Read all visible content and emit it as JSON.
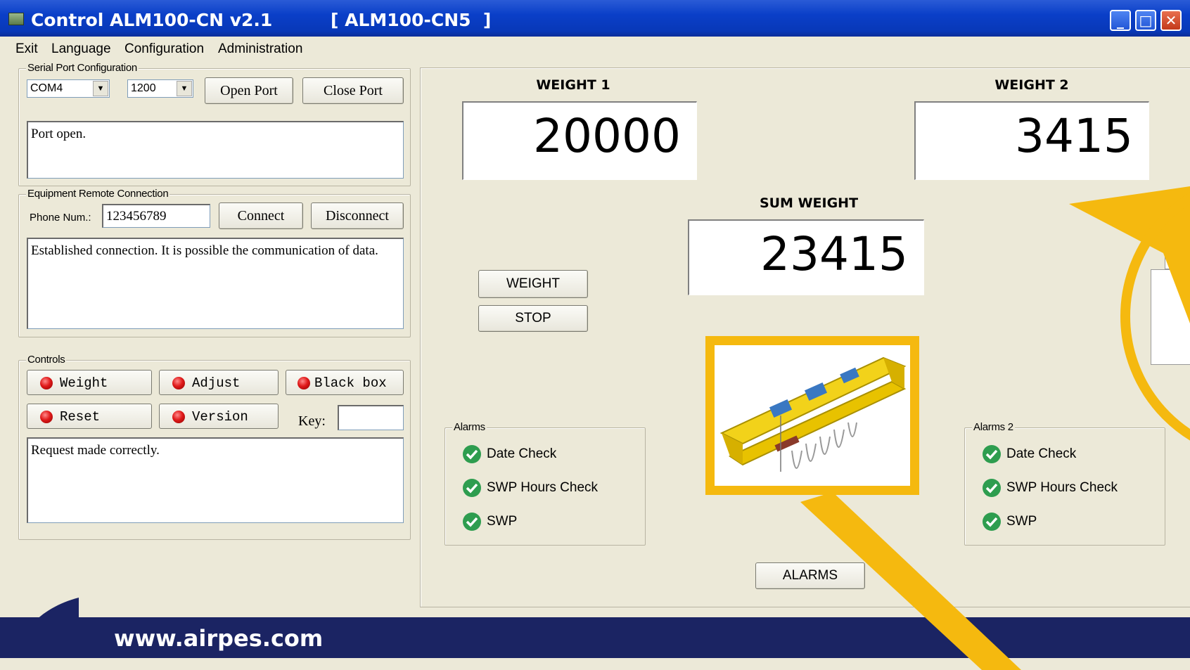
{
  "window": {
    "title": "Control ALM100-CN v2.1",
    "model": "[ ALM100-CN5  ]",
    "minimize": "_",
    "maximize": "□",
    "close": "✕"
  },
  "menu": {
    "items": [
      "Exit",
      "Language",
      "Configuration",
      "Administration"
    ]
  },
  "serial": {
    "group_label": "Serial Port Configuration",
    "port": "COM4",
    "baud": "1200",
    "open_label": "Open Port",
    "close_label": "Close Port",
    "status": "Port open."
  },
  "remote": {
    "group_label": "Equipment Remote Connection",
    "phone_label": "Phone Num.:",
    "phone_value": "123456789",
    "connect_label": "Connect",
    "disconnect_label": "Disconnect",
    "status": "Established connection. It is possible the communication of data."
  },
  "controls": {
    "group_label": "Controls",
    "weight": "Weight",
    "adjust": "Adjust",
    "blackbox": "Black box",
    "reset": "Reset",
    "version": "Version",
    "key_label": "Key:",
    "key_value": "",
    "status": "Request made correctly."
  },
  "weights": {
    "w1_label": "WEIGHT 1",
    "w1_value": "20000",
    "w2_label": "WEIGHT 2",
    "w2_value": "3415",
    "sum_label": "SUM WEIGHT",
    "sum_value": "23415",
    "weight_btn": "WEIGHT",
    "stop_btn": "STOP"
  },
  "alarms": {
    "group1_label": "Alarms",
    "group2_label": "Alarms 2",
    "items": [
      "Date Check",
      "SWP Hours Check",
      "SWP"
    ],
    "alarms_btn": "ALARMS"
  },
  "footer": {
    "url": "www.airpes.com"
  },
  "colors": {
    "titlebar": "#0a3fc8",
    "highlight": "#f5b90f",
    "footer": "#1b2463",
    "check": "#2e9d4f",
    "led": "#e01a1a"
  },
  "icons": [
    "app-icon",
    "check-icon",
    "led-icon",
    "chevron-down-icon",
    "airpes-logo"
  ]
}
